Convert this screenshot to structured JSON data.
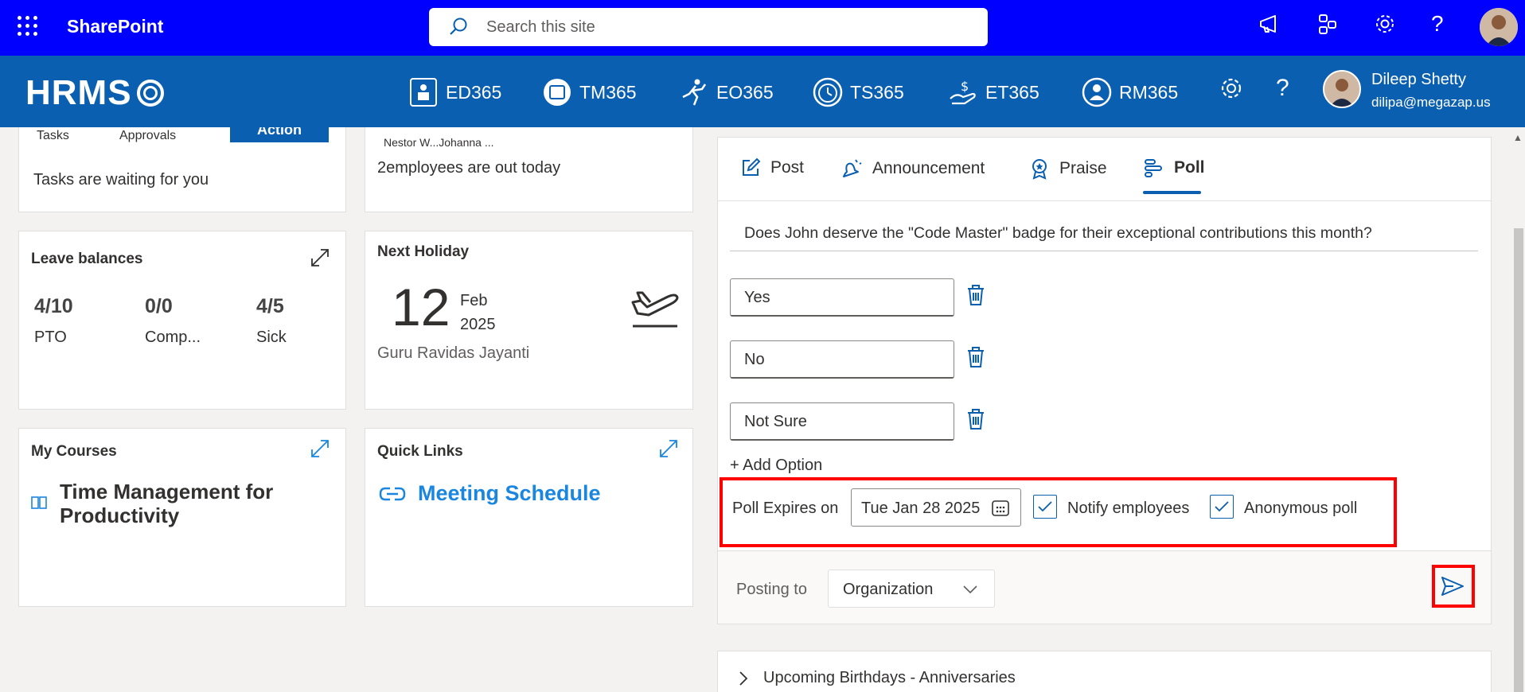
{
  "sp": {
    "title": "SharePoint",
    "search_placeholder": "Search this site"
  },
  "hrms": {
    "logo": "HRMS",
    "modules": [
      "ED365",
      "TM365",
      "EO365",
      "TS365",
      "ET365",
      "RM365"
    ],
    "user_name": "Dileep Shetty",
    "user_email": "dilipa@megazap.us"
  },
  "tasks_card": {
    "tab1": "Tasks",
    "tab2": "Approvals",
    "action": "Action",
    "message": "Tasks are waiting for you"
  },
  "out_card": {
    "names": "Nestor W...Johanna ...",
    "message": "2employees are out today"
  },
  "leave": {
    "title": "Leave balances",
    "items": [
      {
        "value": "4/10",
        "label": "PTO"
      },
      {
        "value": "0/0",
        "label": "Comp..."
      },
      {
        "value": "4/5",
        "label": "Sick"
      }
    ]
  },
  "holiday": {
    "title": "Next Holiday",
    "day": "12",
    "month": "Feb",
    "year": "2025",
    "name": "Guru Ravidas Jayanti"
  },
  "courses": {
    "title": "My Courses",
    "course": "Time Management for Productivity"
  },
  "links": {
    "title": "Quick Links",
    "link": "Meeting Schedule"
  },
  "poll": {
    "tabs": [
      "Post",
      "Announcement",
      "Praise",
      "Poll"
    ],
    "active_tab": "Poll",
    "question": "Does John deserve the \"Code Master\" badge for their exceptional contributions this month?",
    "options": [
      "Yes",
      "No",
      "Not Sure"
    ],
    "add_option": "+ Add Option",
    "expires_label": "Poll Expires on",
    "expires_date": "Tue Jan 28 2025",
    "notify_label": "Notify employees",
    "notify_checked": true,
    "anonymous_label": "Anonymous poll",
    "anonymous_checked": true,
    "posting_to_label": "Posting to",
    "posting_to_value": "Organization"
  },
  "birthdays": {
    "title": "Upcoming Birthdays - Anniversaries"
  },
  "colors": {
    "sp_bar": "#0000ff",
    "hrms_bar": "#0b5fb0",
    "accent": "#0b5fb0",
    "link": "#1a86e0",
    "highlight": "#ff0000"
  }
}
